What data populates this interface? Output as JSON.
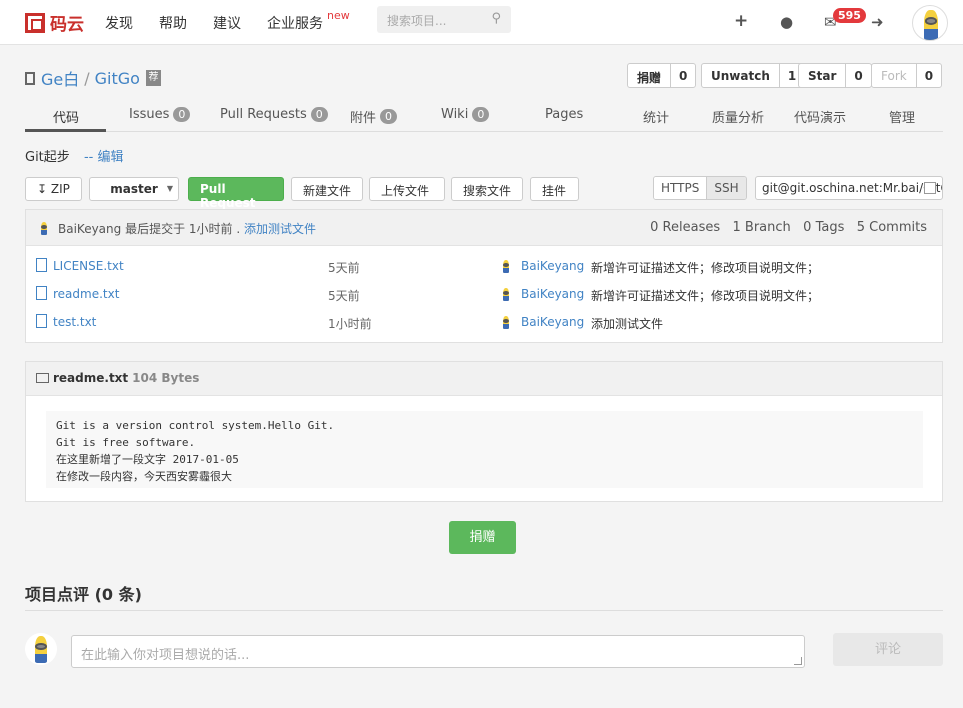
{
  "brand": {
    "name": "码云",
    "accent": "#c9302c"
  },
  "nav": {
    "items": [
      {
        "label": "发现"
      },
      {
        "label": "帮助"
      },
      {
        "label": "建议"
      },
      {
        "label": "企业服务"
      }
    ],
    "new_tag": "new",
    "search_placeholder": "搜索项目...",
    "mail_count": "595"
  },
  "repo": {
    "owner": "Ge白",
    "sep": "/",
    "name": "GitGo",
    "recommend_tag": "荐"
  },
  "actions": [
    {
      "label": "捐赠",
      "count": "0"
    },
    {
      "label": "Unwatch",
      "count": "1"
    },
    {
      "label": "Star",
      "count": "0"
    },
    {
      "label": "Fork",
      "count": "0"
    }
  ],
  "tabs": [
    {
      "label": "代码",
      "count": null
    },
    {
      "label": "Issues",
      "count": "0"
    },
    {
      "label": "Pull Requests",
      "count": "0"
    },
    {
      "label": "附件",
      "count": "0"
    },
    {
      "label": "Wiki",
      "count": "0"
    },
    {
      "label": "Pages",
      "count": null
    },
    {
      "label": "统计",
      "count": null
    },
    {
      "label": "质量分析",
      "count": null
    },
    {
      "label": "代码演示",
      "count": null
    },
    {
      "label": "管理",
      "count": null
    }
  ],
  "breadcrumb": {
    "text": "Git起步",
    "edit": "-- 编辑"
  },
  "toolbar": {
    "zip": "ZIP",
    "branch": "master",
    "pull_request": "Pull Request",
    "new_file": "新建文件",
    "upload": "上传文件",
    "search_file": "搜索文件",
    "widget": "挂件",
    "https": "HTTPS",
    "ssh": "SSH",
    "clone_url": "git@git.oschina.net:Mr.bai/GitGo.git"
  },
  "latest_commit": {
    "author": "BaiKeyang",
    "text": " 最后提交于 1小时前 .",
    "message": "添加测试文件",
    "stats": "0 Releases   1 Branch   0 Tags   5 Commits"
  },
  "files": [
    {
      "name": "LICENSE.txt",
      "time": "5天前",
      "author": "BaiKeyang",
      "message": "新增许可证描述文件；修改项目说明文件；"
    },
    {
      "name": "readme.txt",
      "time": "5天前",
      "author": "BaiKeyang",
      "message": "新增许可证描述文件；修改项目说明文件；"
    },
    {
      "name": "test.txt",
      "time": "1小时前",
      "author": "BaiKeyang",
      "message": "添加测试文件"
    }
  ],
  "readme": {
    "name": "readme.txt",
    "size": "104 Bytes",
    "lines": [
      "Git is a version control system.Hello Git.",
      "Git is free software.",
      "在这里新增了一段文字 2017-01-05",
      "在修改一段内容，今天西安雾霾很大"
    ]
  },
  "donate_label": "捐赠",
  "review": {
    "title": "项目点评 (0 条)",
    "placeholder": "在此输入你对项目想说的话...",
    "submit": "评论"
  }
}
